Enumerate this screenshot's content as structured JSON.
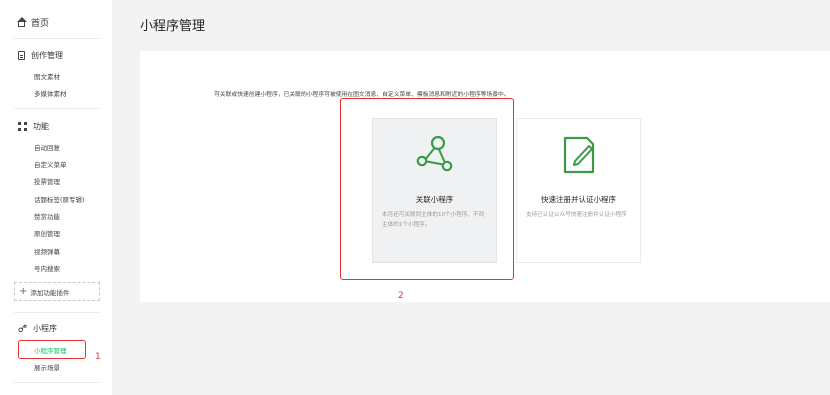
{
  "sidebar": {
    "home": "首页",
    "sections": [
      {
        "title": "创作管理",
        "icon": "document-icon",
        "items": [
          "图文素材",
          "多媒体素材"
        ]
      },
      {
        "title": "功能",
        "icon": "grid-icon",
        "items": [
          "自动回复",
          "自定义菜单",
          "投票管理",
          "话题标签(原专辑)",
          "赞赏功能",
          "原创管理",
          "视频弹幕",
          "号内搜索"
        ]
      },
      {
        "title": "小程序",
        "icon": "miniprogram-icon",
        "items": [
          "小程序管理",
          "展示场景"
        ]
      }
    ],
    "add_plugin": "添加功能插件",
    "active_item": "小程序管理"
  },
  "page": {
    "title": "小程序管理",
    "description": "可关联或快速创建小程序，已关联的小程序可被使用在图文消息、自定义菜单、模板消息和附近的小程序等场景中。"
  },
  "cards": {
    "associate": {
      "title": "关联小程序",
      "desc": "本月还可关联同主体的10个小程序、不同主体的1个小程序。"
    },
    "quick_register": {
      "title": "快速注册并认证小程序",
      "desc": "支持已认证公众号快速注册并认证小程序"
    }
  },
  "annotations": {
    "mark1": "1",
    "mark2": "2"
  },
  "colors": {
    "accent": "#07c160",
    "annotation": "#e53333"
  }
}
